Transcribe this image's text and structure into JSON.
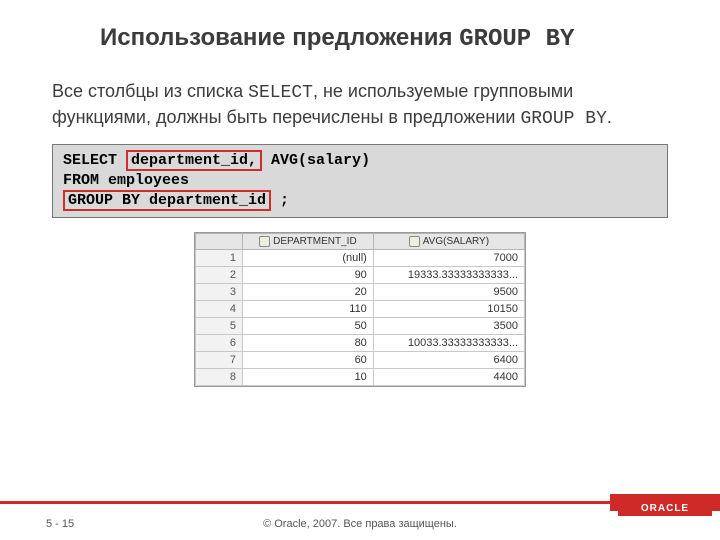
{
  "title": {
    "prefix": "Использование предложения ",
    "kw": "GROUP BY"
  },
  "body": {
    "p1a": "Все столбцы из списка ",
    "p1b": "SELECT",
    "p1c": ", не используемые групповыми функциями, должны быть перечислены в предложении ",
    "p1d": "GROUP BY",
    "p1e": "."
  },
  "sql": {
    "select_kw": "SELECT   ",
    "col1": "department_id,",
    "agg": " AVG(salary)",
    "from": "FROM     employees",
    "group_kw": "GROUP BY department_id",
    "semi": " ;"
  },
  "result": {
    "headers": [
      "DEPARTMENT_ID",
      "AVG(SALARY)"
    ],
    "rows": [
      {
        "n": "1",
        "dept": "(null)",
        "avg": "7000"
      },
      {
        "n": "2",
        "dept": "90",
        "avg": "19333.33333333333..."
      },
      {
        "n": "3",
        "dept": "20",
        "avg": "9500"
      },
      {
        "n": "4",
        "dept": "110",
        "avg": "10150"
      },
      {
        "n": "5",
        "dept": "50",
        "avg": "3500"
      },
      {
        "n": "6",
        "dept": "80",
        "avg": "10033.33333333333..."
      },
      {
        "n": "7",
        "dept": "60",
        "avg": "6400"
      },
      {
        "n": "8",
        "dept": "10",
        "avg": "4400"
      }
    ]
  },
  "footer": {
    "page": "5 - 15",
    "copy": "© Oracle, 2007. Все права защищены.",
    "brand": "ORACLE"
  },
  "chart_data": {
    "type": "table",
    "title": "AVG(salary) grouped by department_id",
    "columns": [
      "DEPARTMENT_ID",
      "AVG(SALARY)"
    ],
    "rows": [
      [
        null,
        7000
      ],
      [
        90,
        19333.33333333333
      ],
      [
        20,
        9500
      ],
      [
        110,
        10150
      ],
      [
        50,
        3500
      ],
      [
        80,
        10033.33333333333
      ],
      [
        60,
        6400
      ],
      [
        10,
        4400
      ]
    ]
  }
}
